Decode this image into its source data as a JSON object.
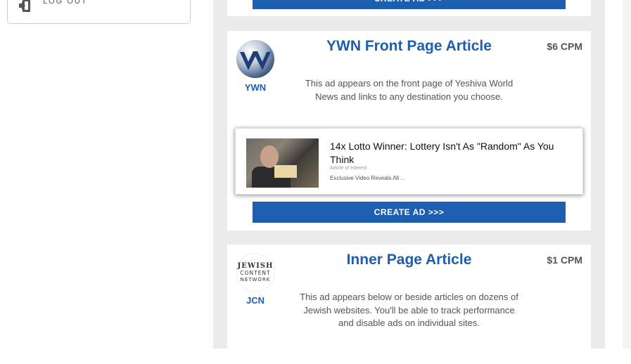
{
  "sidebar": {
    "logout_label": "LOG OUT"
  },
  "top_card": {
    "cta_label": "CREATE AD >>>"
  },
  "ad_options": [
    {
      "short_name": "YWN",
      "title": "YWN Front Page Article",
      "price": "$6 CPM",
      "description": "This ad appears on the front page of Yeshiva World News and links to any destination you choose.",
      "preview": {
        "headline": "14x Lotto Winner: Lottery Isn't As \"Random\" As You Think",
        "tag": "Article of Interest",
        "subtext": "Exclusive Video Reveals All ..."
      },
      "cta_label": "CREATE AD >>>"
    },
    {
      "short_name": "JCN",
      "logo_text": [
        "JEWISH",
        "CONTENT",
        "NETWORK"
      ],
      "title": "Inner Page Article",
      "price": "$1 CPM",
      "description": "This ad appears below or beside articles on dozens of Jewish websites. You'll be able to track performance and disable ads on individual sites."
    }
  ],
  "colors": {
    "accent": "#1d5eb0",
    "panel_bg": "#ebebeb"
  },
  "icons": {
    "logout": "logout-icon",
    "ywn_logo": "ywn-logo",
    "jcn_logo": "jcn-logo"
  }
}
